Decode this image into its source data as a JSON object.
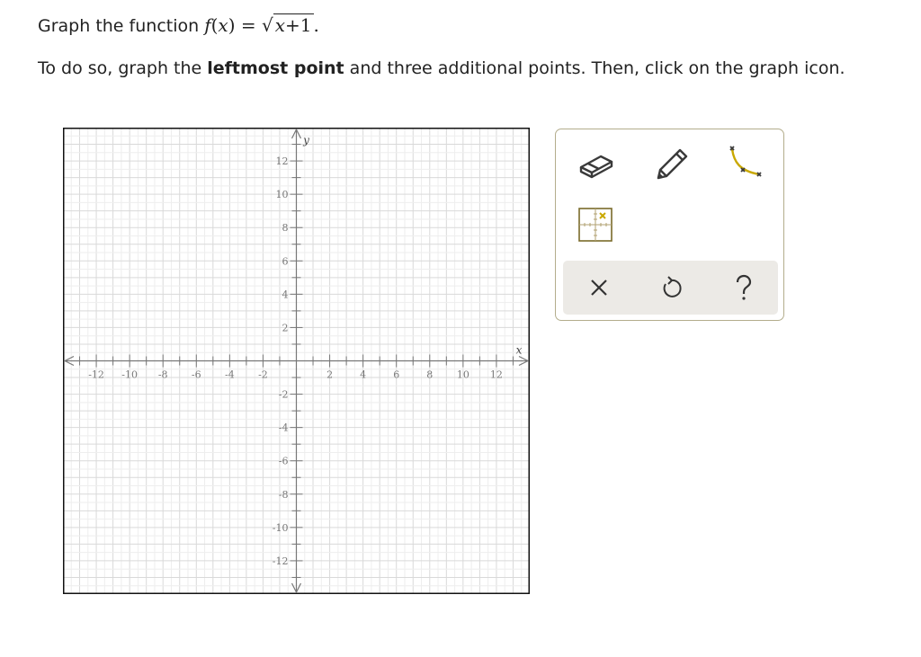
{
  "question": {
    "line1_prefix": "Graph the function",
    "func_name": "f",
    "func_var": "x",
    "func_equals": "=",
    "sqrt_body_var": "x",
    "sqrt_body_rest": "+1",
    "line1_suffix": ".",
    "line2_part1": "To do so, graph the ",
    "line2_bold": "leftmost point",
    "line2_part2": " and three additional points. Then, click on the graph icon."
  },
  "graph": {
    "xlabel": "x",
    "ylabel": "y",
    "xlim": [
      -14,
      14
    ],
    "ylim": [
      -14,
      14
    ],
    "x_tick_labels": [
      "-12",
      "-10",
      "-8",
      "-6",
      "-4",
      "-2",
      "2",
      "4",
      "6",
      "8",
      "10",
      "12"
    ],
    "y_tick_labels": [
      "12",
      "10",
      "8",
      "6",
      "4",
      "2",
      "-2",
      "-4",
      "-6",
      "-8",
      "-10",
      "-12"
    ],
    "grid": true,
    "grid_color": "#d9d9d9",
    "axis_color": "#777777"
  },
  "toolbox": {
    "tools": [
      "eraser-tool",
      "pencil-tool",
      "curve-tool",
      "point-grid-tool"
    ],
    "actions": [
      "clear",
      "undo",
      "help"
    ],
    "accent_color": "#7a6a2a",
    "highlight_color": "#c9a800"
  }
}
